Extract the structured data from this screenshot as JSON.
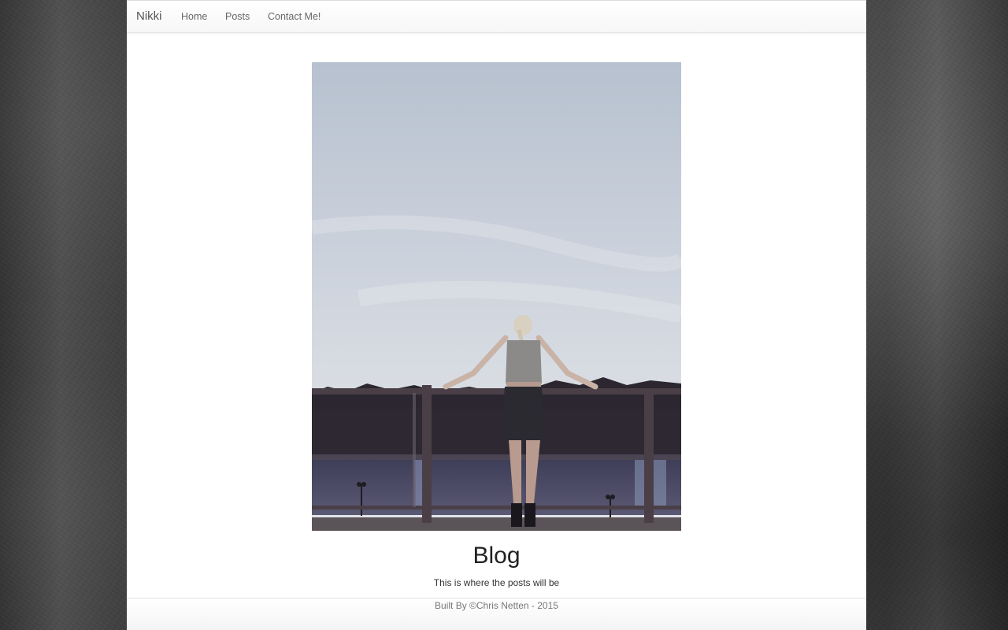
{
  "navbar": {
    "brand": "Nikki",
    "links": [
      "Home",
      "Posts",
      "Contact Me!"
    ]
  },
  "main": {
    "title": "Blog",
    "subtitle": "This is where the posts will be"
  },
  "footer": {
    "text": "Built By ©Chris Netten - 2015"
  },
  "colors": {
    "page_background": "#ffffff",
    "body_background": "#3a3a3a",
    "navbar_text": "#666666",
    "title_text": "#222222"
  }
}
